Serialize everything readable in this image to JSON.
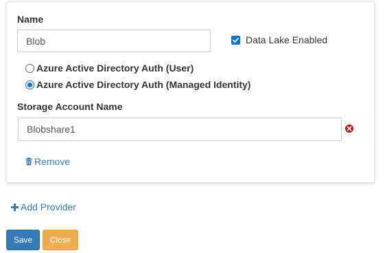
{
  "provider": {
    "name_label": "Name",
    "name_value": "Blob",
    "data_lake_label": "Data Lake Enabled",
    "data_lake_checked": true,
    "auth_options": [
      {
        "label": "Azure Active Directory Auth (User)",
        "selected": false
      },
      {
        "label": "Azure Active Directory Auth (Managed Identity)",
        "selected": true
      }
    ],
    "storage_label": "Storage Account Name",
    "storage_value": "Blobshare1",
    "remove_label": "Remove"
  },
  "actions": {
    "add_provider_label": "Add Provider",
    "save_label": "Save",
    "close_label": "Close"
  },
  "colors": {
    "primary": "#337ab7",
    "warning": "#f0ad4e",
    "checkbox": "#0b73d8",
    "danger": "#b71c1c"
  },
  "icons": {
    "check": "check-icon",
    "remove_field": "times-circle-icon",
    "trash": "trash-icon",
    "plus": "plus-icon"
  }
}
